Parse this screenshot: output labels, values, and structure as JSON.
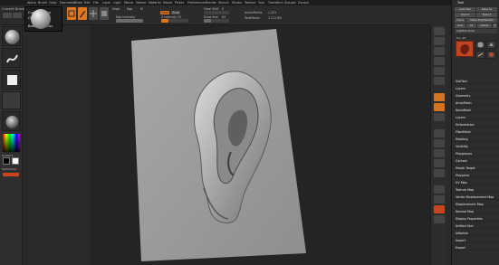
{
  "menubar": {
    "items": [
      "Alpha",
      "Brush",
      "Color",
      "Document",
      "Draw",
      "Edit",
      "File",
      "Layer",
      "Light",
      "Macro",
      "Marker",
      "Material",
      "Movie",
      "Picker",
      "Preferences",
      "Render",
      "Stencil",
      "Stroke",
      "Texture",
      "Tool",
      "Transform",
      "Zplugin",
      "Zscript"
    ]
  },
  "left_header": {
    "label": "Current Brush",
    "sub": "ClayTubes"
  },
  "tooltip": {
    "line1": "Current Brush",
    "line2": "ClayTubes",
    "hotkey": "Base Type: Cov"
  },
  "topbar": {
    "zadd_label": "Zadd",
    "zsub_label": "Zsub",
    "rgb_intensity_label": "Rgb Intensity",
    "rgb_intensity_value": 100,
    "z_intensity_label": "Z Intensity",
    "z_intensity_value": 25,
    "focal_shift_label": "Focal Shift",
    "focal_shift_value": 0,
    "draw_size_label": "Draw Size",
    "draw_size_value": 64,
    "active_points_label": "ActivePoints",
    "active_points_value": "1.201",
    "total_points_label": "TotalPoints",
    "total_points_value": "1.211 Mil"
  },
  "left_swatch": {
    "label": "SwitchColor",
    "gradient_label": "Gradient"
  },
  "tool_panel": {
    "title": "Tool",
    "buttons": [
      "Load Tool",
      "Save As",
      "Import",
      "Export",
      "Clone",
      "Make PolyMesh3D",
      "GoZ",
      "All",
      "Visible",
      "R"
    ],
    "lightbox_label": "Lightbox Tools",
    "tool_name": "Ear_48",
    "subpalettes": [
      "SubTool",
      "Layers",
      "Geometry",
      "ArrayMesh",
      "NanoMesh",
      "Layers",
      "Deformation",
      "FiberMesh",
      "Masking",
      "Visibility",
      "Polygroups",
      "Contact",
      "Morph Target",
      "Polypaint",
      "UV Map",
      "Texture Map",
      "Vector Displacement Map",
      "Displacement Map",
      "Normal Map",
      "Display Properties",
      "Unified Skin",
      "Initialize",
      "Import",
      "Export"
    ]
  },
  "colors": {
    "accent": "#e2761c",
    "bg": "#2a2a2a",
    "panel": "#2c2c2c",
    "canvas": "#242424"
  }
}
